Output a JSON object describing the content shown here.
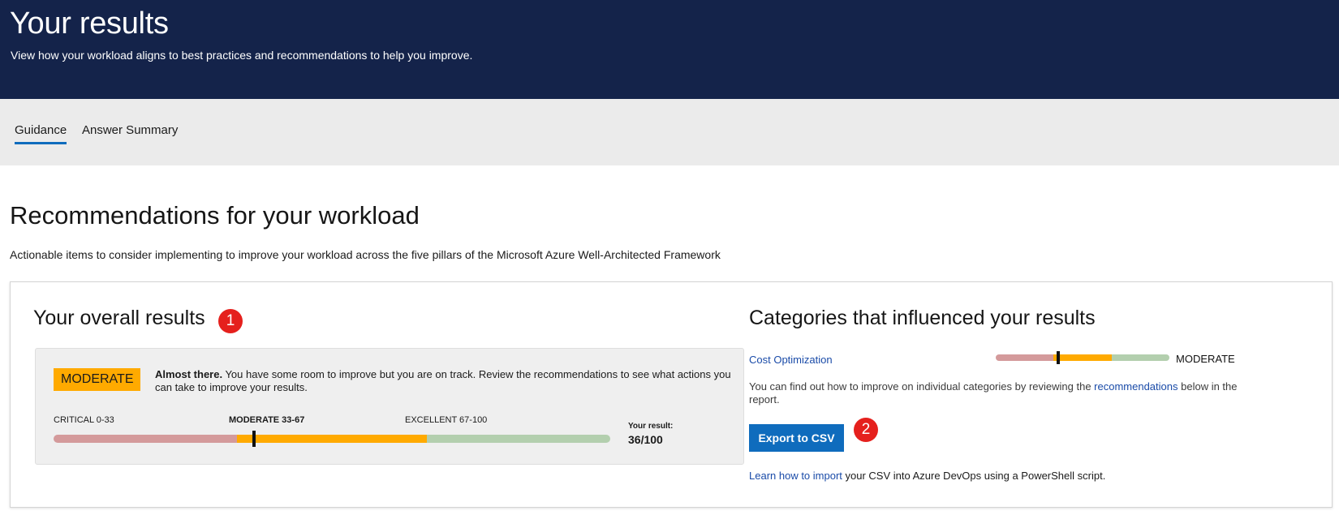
{
  "hero": {
    "title": "Your results",
    "subtitle": "View how your workload aligns to best practices and recommendations to help you improve."
  },
  "tabs": [
    {
      "label": "Guidance",
      "active": true
    },
    {
      "label": "Answer Summary",
      "active": false
    }
  ],
  "section": {
    "title": "Recommendations for your workload",
    "subtitle": "Actionable items to consider implementing to improve your workload across the five pillars of the Microsoft Azure Well-Architected Framework"
  },
  "overall": {
    "title": "Your overall results",
    "badge": "1",
    "level": "MODERATE",
    "desc_bold": "Almost there.",
    "desc_rest": " You have some room to improve but you are on track. Review the recommendations to see what actions you can take to improve your results.",
    "scale": {
      "critical": "CRITICAL 0-33",
      "moderate": "MODERATE 33-67",
      "excellent": "EXCELLENT 67-100"
    },
    "result_label": "Your result:",
    "result_value": "36/100",
    "score": 36
  },
  "categories": {
    "title": "Categories that influenced your results",
    "items": [
      {
        "name": "Cost Optimization",
        "level": "MODERATE",
        "score": 36
      }
    ],
    "desc_before": "You can find out how to improve on individual categories by reviewing the ",
    "desc_link": "recommendations",
    "desc_after": " below in the report.",
    "export_label": "Export to CSV",
    "badge": "2",
    "learn_link": "Learn how to import",
    "learn_rest": " your CSV into Azure DevOps using a PowerShell script."
  },
  "colors": {
    "hero_bg": "#14234a",
    "critical": "#d49a9b",
    "moderate": "#ffaa00",
    "excellent": "#b3cfae",
    "accent": "#0f6cbd",
    "badge": "#e5201d",
    "link": "#1a4ba8"
  }
}
